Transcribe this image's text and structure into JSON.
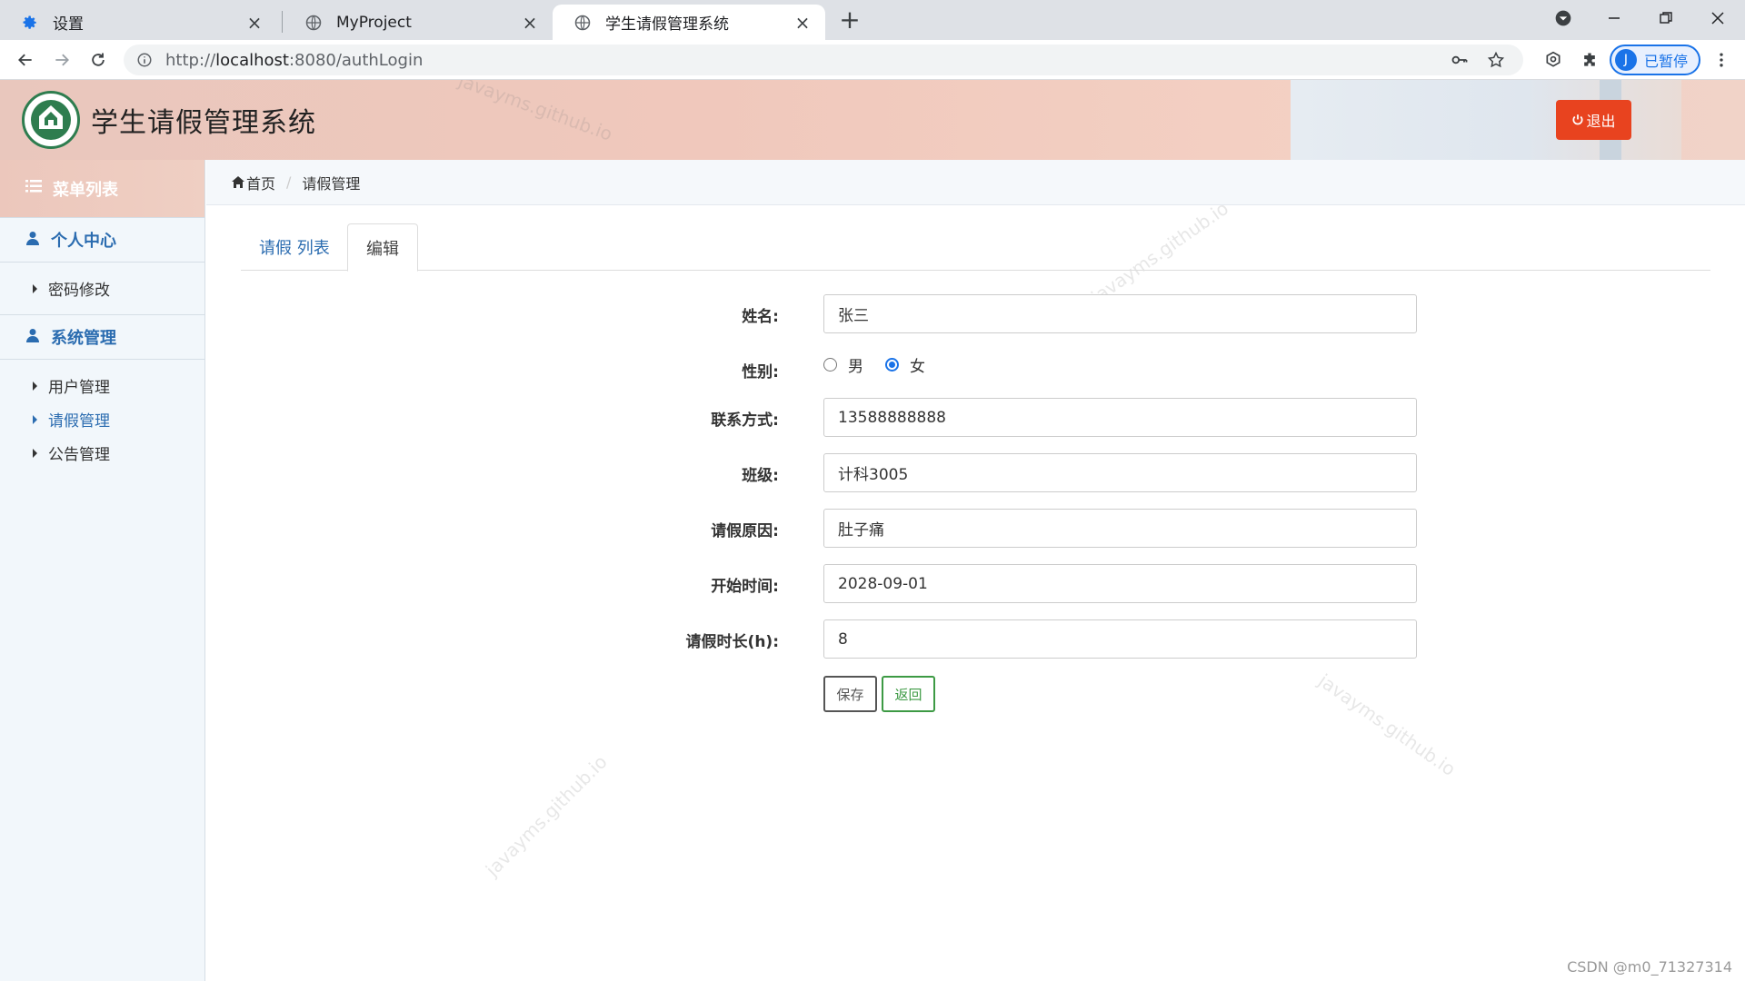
{
  "browser": {
    "tabs": [
      {
        "title": "设置",
        "icon": "gear-icon"
      },
      {
        "title": "MyProject",
        "icon": "globe-icon"
      },
      {
        "title": "学生请假管理系统",
        "icon": "globe-icon"
      }
    ],
    "url_prefix": "http://",
    "url_host": "localhost",
    "url_rest": ":8080/authLogin",
    "profile_initial": "J",
    "profile_label": "已暂停"
  },
  "header": {
    "title": "学生请假管理系统",
    "logout_label": "退出",
    "watermark": "javayms.github.io"
  },
  "sidebar": {
    "menu_title": "菜单列表",
    "groups": [
      {
        "label": "个人中心",
        "items": [
          {
            "label": "密码修改"
          }
        ]
      },
      {
        "label": "系统管理",
        "items": [
          {
            "label": "用户管理"
          },
          {
            "label": "请假管理"
          },
          {
            "label": "公告管理"
          }
        ]
      }
    ],
    "active_item": "请假管理"
  },
  "breadcrumb": {
    "home": "首页",
    "current": "请假管理"
  },
  "tabs": [
    {
      "label": "请假 列表"
    },
    {
      "label": "编辑"
    }
  ],
  "form": {
    "name_label": "姓名:",
    "name_value": "张三",
    "gender_label": "性别:",
    "gender_options": [
      "男",
      "女"
    ],
    "gender_selected": "女",
    "contact_label": "联系方式:",
    "contact_value": "13588888888",
    "class_label": "班级:",
    "class_value": "计科3005",
    "reason_label": "请假原因:",
    "reason_value": "肚子痛",
    "start_label": "开始时间:",
    "start_value": "2028-09-01",
    "duration_label": "请假时长(h):",
    "duration_value": "8",
    "save_label": "保存",
    "back_label": "返回"
  },
  "footer_mark": "CSDN @m0_71327314",
  "colors": {
    "accent_blue": "#2b6cb0",
    "logout_red": "#e8431f",
    "back_green": "#3d9a44"
  }
}
